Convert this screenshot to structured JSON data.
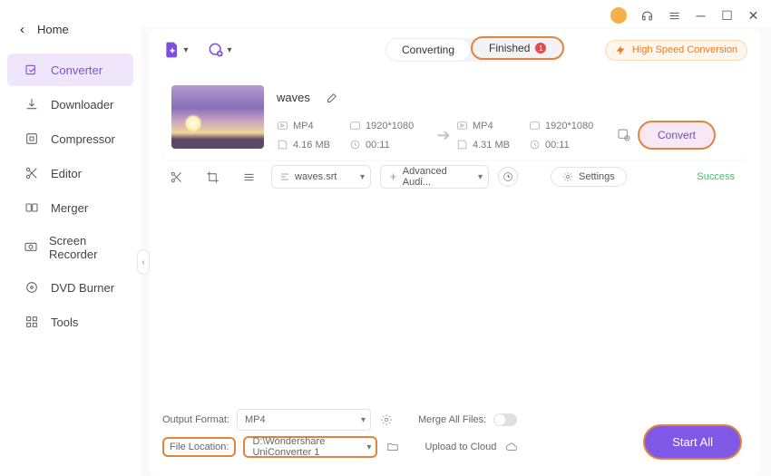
{
  "sidebar": {
    "home": "Home",
    "items": [
      {
        "label": "Converter"
      },
      {
        "label": "Downloader"
      },
      {
        "label": "Compressor"
      },
      {
        "label": "Editor"
      },
      {
        "label": "Merger"
      },
      {
        "label": "Screen Recorder"
      },
      {
        "label": "DVD Burner"
      },
      {
        "label": "Tools"
      }
    ]
  },
  "tabs": {
    "converting": "Converting",
    "finished": "Finished",
    "finished_count": "1"
  },
  "hs_badge": "High Speed Conversion",
  "file": {
    "name": "waves",
    "in_fmt": "MP4",
    "in_res": "1920*1080",
    "in_size": "4.16 MB",
    "in_dur": "00:11",
    "out_fmt": "MP4",
    "out_res": "1920*1080",
    "out_size": "4.31 MB",
    "out_dur": "00:11",
    "convert_label": "Convert",
    "subtitle_sel": "waves.srt",
    "audio_sel": "Advanced Audi...",
    "settings_label": "Settings",
    "status": "Success"
  },
  "bottom": {
    "output_format_label": "Output Format:",
    "output_format_value": "MP4",
    "merge_label": "Merge All Files:",
    "file_location_label": "File Location:",
    "file_location_value": "D:\\Wondershare UniConverter 1",
    "upload_label": "Upload to Cloud",
    "start_all": "Start All"
  }
}
